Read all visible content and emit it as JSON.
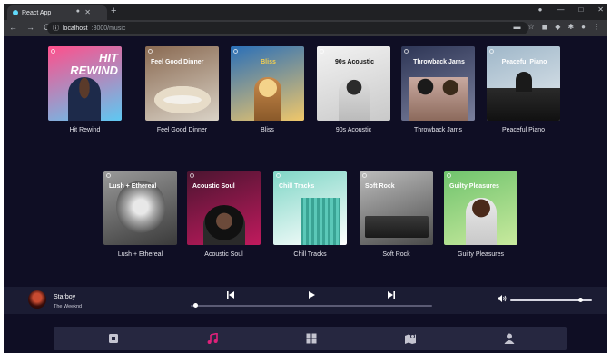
{
  "browser": {
    "tab_title": "React App",
    "new_tab": "+",
    "url_host": "localhost",
    "url_path": ":3000/music",
    "window_controls": [
      "—",
      "□",
      "✕"
    ]
  },
  "playlists": [
    {
      "label": "Hit Rewind",
      "cover_text": "HIT REWIND",
      "colors": [
        "#ff4f8b",
        "#5ec8f2"
      ]
    },
    {
      "label": "Feel Good Dinner",
      "cover_text": "Feel Good Dinner",
      "colors": [
        "#8a6a52",
        "#d9d2c6"
      ]
    },
    {
      "label": "Bliss",
      "cover_text": "Bliss",
      "colors": [
        "#2a6fb8",
        "#f0c76a"
      ]
    },
    {
      "label": "90s Acoustic",
      "cover_text": "90s Acoustic",
      "colors": [
        "#f2f2f2",
        "#c9c9c9"
      ]
    },
    {
      "label": "Throwback Jams",
      "cover_text": "Throwback Jams",
      "colors": [
        "#2e3656",
        "#7a7f9c"
      ]
    },
    {
      "label": "Peaceful Piano",
      "cover_text": "Peaceful Piano",
      "colors": [
        "#9fb7c9",
        "#e5ebef"
      ]
    },
    {
      "label": "Lush + Ethereal",
      "cover_text": "Lush + Ethereal",
      "colors": [
        "#9a9a9a",
        "#3a3a3a"
      ]
    },
    {
      "label": "Acoustic Soul",
      "cover_text": "Acoustic Soul",
      "colors": [
        "#4a1530",
        "#c01a5d"
      ]
    },
    {
      "label": "Chill Tracks",
      "cover_text": "Chill Tracks",
      "colors": [
        "#7fd6c6",
        "#ffffff"
      ]
    },
    {
      "label": "Soft Rock",
      "cover_text": "Soft Rock",
      "colors": [
        "#bdbdbd",
        "#4a4a4a"
      ]
    },
    {
      "label": "Guilty Pleasures",
      "cover_text": "Guilty Pleasures",
      "colors": [
        "#6fc36d",
        "#c9ea9e"
      ]
    }
  ],
  "player": {
    "track_title": "Starboy",
    "artist": "The Weeknd",
    "progress": 0.02,
    "volume": 0.85
  },
  "nav": {
    "items": [
      "home-icon",
      "music-icon",
      "grid-icon",
      "map-icon",
      "user-icon"
    ],
    "active": "music-icon",
    "active_color": "#e0217b"
  }
}
